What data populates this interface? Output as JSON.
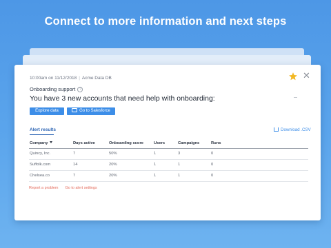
{
  "hero": {
    "title": "Connect to more information and next steps"
  },
  "card": {
    "timestamp": "10:00am on 11/12/2018",
    "source": "Acme Data DB",
    "section_title": "Onboarding support",
    "message": "You have 3 new accounts that need help with onboarding:",
    "buttons": {
      "explore": "Explore data",
      "salesforce": "Go to Salesforce"
    },
    "tab_label": "Alert results",
    "download_label": "Download .CSV",
    "columns": [
      "Company",
      "Days active",
      "Onboarding score",
      "Users",
      "Campaigns",
      "Runs"
    ],
    "rows": [
      [
        "Quincy, Inc.",
        "7",
        "50%",
        "1",
        "3",
        "0"
      ],
      [
        "Suffolk.com",
        "14",
        "20%",
        "1",
        "1",
        "0"
      ],
      [
        "Chelsea.co",
        "7",
        "20%",
        "1",
        "1",
        "0"
      ]
    ],
    "footer_links": [
      "Report a problem",
      "Go to alert settings"
    ]
  },
  "colors": {
    "accent": "#3d8ee8",
    "star": "#f2b824",
    "link_red": "#e46a5a"
  },
  "icons": {
    "favorite": "star-icon",
    "close": "close-icon",
    "help": "help-icon",
    "salesforce": "salesforce-icon",
    "download": "download-icon",
    "sort": "sort-down-icon"
  }
}
